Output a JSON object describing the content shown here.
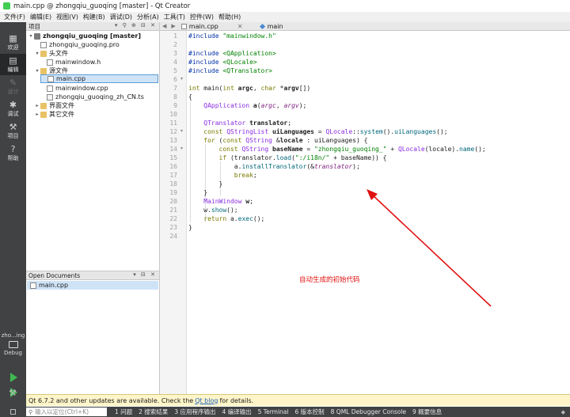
{
  "window": {
    "title": "main.cpp @ zhongqiu_guoqing [master] - Qt Creator"
  },
  "menu": [
    "文件(F)",
    "编辑(E)",
    "视图(V)",
    "构建(B)",
    "调试(D)",
    "分析(A)",
    "工具(T)",
    "控件(W)",
    "帮助(H)"
  ],
  "modes": [
    {
      "label": "欢迎",
      "icon": "grid-icon"
    },
    {
      "label": "编辑",
      "icon": "edit-doc-icon"
    },
    {
      "label": "设计",
      "icon": "pencil-icon"
    },
    {
      "label": "调试",
      "icon": "bug-icon"
    },
    {
      "label": "项目",
      "icon": "wrench-icon"
    },
    {
      "label": "帮助",
      "icon": "help-icon"
    }
  ],
  "kit": {
    "name": "zho...ing",
    "build": "Debug"
  },
  "project_pane": {
    "title": "项目",
    "tree": [
      {
        "label": "zhongqiu_guoqing [master]",
        "level": 0,
        "expanded": true,
        "type": "project"
      },
      {
        "label": "zhongqiu_guoqing.pro",
        "level": 1,
        "type": "pro"
      },
      {
        "label": "头文件",
        "level": 1,
        "expanded": true,
        "type": "folder"
      },
      {
        "label": "mainwindow.h",
        "level": 2,
        "type": "header"
      },
      {
        "label": "源文件",
        "level": 1,
        "expanded": true,
        "type": "folder"
      },
      {
        "label": "main.cpp",
        "level": 2,
        "type": "source",
        "selected": true
      },
      {
        "label": "mainwindow.cpp",
        "level": 2,
        "type": "source"
      },
      {
        "label": "zhongqiu_guoqing_zh_CN.ts",
        "level": 2,
        "type": "ts"
      },
      {
        "label": "界面文件",
        "level": 1,
        "expanded": false,
        "type": "folder"
      },
      {
        "label": "其它文件",
        "level": 1,
        "expanded": false,
        "type": "folder"
      }
    ]
  },
  "open_documents": {
    "title": "Open Documents",
    "items": [
      "main.cpp"
    ]
  },
  "editor": {
    "file_tab": "main.cpp",
    "symbol": "main",
    "line_numbers": [
      "1",
      "2",
      "3",
      "4",
      "5",
      "6",
      "7",
      "8",
      "9",
      "10",
      "11",
      "12",
      "13",
      "14",
      "15",
      "16",
      "17",
      "18",
      "19",
      "20",
      "21",
      "22",
      "23",
      "24"
    ]
  },
  "annotation": "自动生成的初始代码",
  "notification": {
    "text_before": "Qt 6.7.2 and other updates are available. Check the",
    "link": "Qt blog",
    "text_after": "for details."
  },
  "statusbar": {
    "locator_placeholder": "输入以定位(Ctrl+K)",
    "tabs": [
      "1 问题",
      "2 搜索结果",
      "3 应用程序输出",
      "4 编译输出",
      "5 Terminal",
      "6 版本控制",
      "8 QML Debugger Console",
      "9 概要信息"
    ]
  },
  "colors": {
    "modebar": "#404244",
    "selection": "#cfe3f7",
    "annotation": "#e01010",
    "notification": "#fff5c9"
  }
}
